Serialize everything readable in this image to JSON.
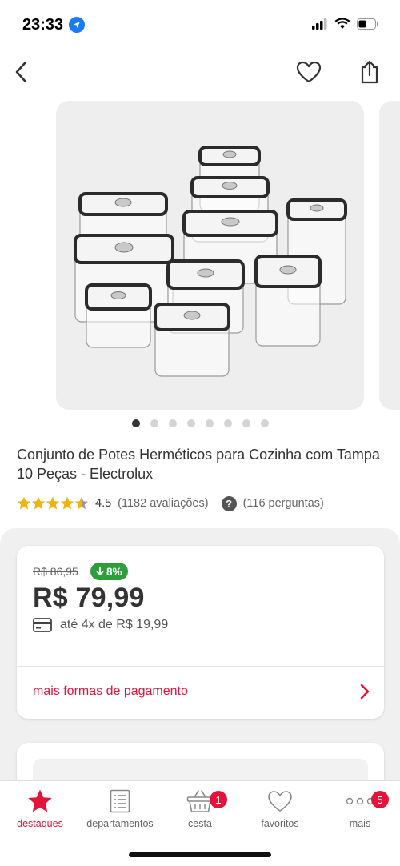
{
  "status_bar": {
    "time": "23:33"
  },
  "gallery": {
    "image_count": 8,
    "active_index": 0
  },
  "product": {
    "title": "Conjunto de Potes Herméticos para Cozinha com Tampa 10 Peças - Electrolux",
    "rating": "4.5",
    "rating_stars": 4.5,
    "reviews": "(1182 avaliações)",
    "questions": "(116 perguntas)",
    "question_icon": "?"
  },
  "pricing": {
    "old_price": "R$ 86,95",
    "discount": "8%",
    "price": "R$ 79,99",
    "installments": "até 4x de R$ 19,99",
    "more_payment_label": "mais formas de pagamento"
  },
  "tabs": [
    {
      "label": "destaques",
      "icon": "star-icon",
      "active": true
    },
    {
      "label": "departamentos",
      "icon": "list-icon",
      "active": false
    },
    {
      "label": "cesta",
      "icon": "basket-icon",
      "badge": "1",
      "active": false
    },
    {
      "label": "favoritos",
      "icon": "heart-icon",
      "active": false
    },
    {
      "label": "mais",
      "icon": "more-icon",
      "badge": "5",
      "active": false
    }
  ],
  "colors": {
    "accent": "#e5133a",
    "discount": "#2e9e3d",
    "star": "#f5b400"
  }
}
